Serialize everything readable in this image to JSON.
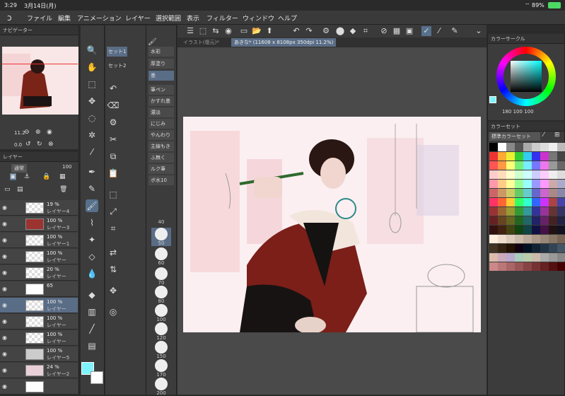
{
  "status": {
    "time": "3:29",
    "date": "3月14日(月)",
    "battery": "89%"
  },
  "menu": [
    "ファイル",
    "編集",
    "アニメーション",
    "レイヤー",
    "選択範囲",
    "表示",
    "フィルター",
    "ウィンドウ",
    "ヘルプ"
  ],
  "navigator": {
    "title": "ナビゲーター",
    "zoom": "11.2",
    "rotation": "0.0"
  },
  "layers": {
    "title": "レイヤー",
    "blend": "通常",
    "opacity": "100",
    "rows": [
      {
        "pct": "19 %",
        "name": "レイヤー4"
      },
      {
        "pct": "100 %",
        "name": "レイヤー3"
      },
      {
        "pct": "100 %",
        "name": "レイヤー1"
      },
      {
        "pct": "100 %",
        "name": "レイヤー"
      },
      {
        "pct": "20 %",
        "name": "レイヤー"
      },
      {
        "pct": "65",
        "name": ""
      },
      {
        "pct": "100 %",
        "name": "レイヤー"
      },
      {
        "pct": "100 %",
        "name": "レイヤー"
      },
      {
        "pct": "100 %",
        "name": "レイヤー"
      },
      {
        "pct": "100 %",
        "name": "レイヤー5"
      },
      {
        "pct": "24 %",
        "name": "レイヤー2"
      },
      {
        "pct": "",
        "name": ""
      }
    ]
  },
  "subtool_tabs": [
    "セット1",
    "セット2"
  ],
  "subtools": [
    "水彩",
    "厚塗り",
    "墨",
    "筆ペン",
    "かすれ墨",
    "濃淡",
    "にじみ",
    "やんわり",
    "主線もき",
    "ふ無く",
    "ルク筆",
    "ボ水10"
  ],
  "brush_sizes": [
    "40",
    "50",
    "60",
    "70",
    "80",
    "100",
    "120",
    "150",
    "170",
    "200"
  ],
  "tabs": {
    "t1": "イラスト(復元)*",
    "t2": "あきな* (11608 x 8108px 350dpi 11.2%)"
  },
  "color_circle": {
    "title": "カラーサークル",
    "values": "180  100  100"
  },
  "color_set": {
    "title": "カラーセット",
    "selected": "標準カラーセット"
  },
  "colors": {
    "fg": "#7ef3fb",
    "bg": "#ffffff"
  }
}
